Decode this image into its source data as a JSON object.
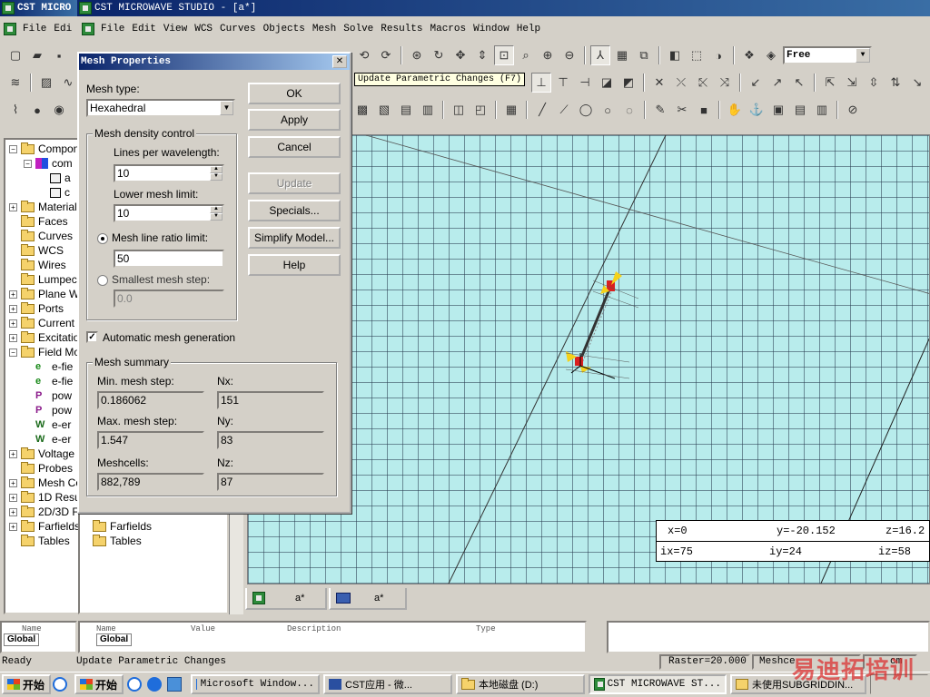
{
  "back_window": {
    "title": "CST MICRO"
  },
  "main_window": {
    "title": "CST MICROWAVE STUDIO - [a*]"
  },
  "back_menu": [
    {
      "label": "File",
      "u": "F",
      "rest": "ile"
    },
    {
      "label": "Edi",
      "u": "",
      "rest": "Edi"
    }
  ],
  "menu": [
    "File",
    "Edit",
    "View",
    "WCS",
    "Curves",
    "Objects",
    "Mesh",
    "Solve",
    "Results",
    "Macros",
    "Window",
    "Help"
  ],
  "toolbar": {
    "mode_select": "Free"
  },
  "tooltip": "Update Parametric Changes (F7)",
  "tree_left": {
    "items": [
      "Compon",
      "com",
      "a",
      "c",
      "Material",
      "Faces",
      "Curves",
      "WCS",
      "Wires",
      "Lumpec",
      "Plane W",
      "Ports",
      "Current",
      "Excitatio",
      "Field Mo",
      "e-fie",
      "e-fie",
      "pow",
      "pow",
      "e-er",
      "e-er",
      "Voltage",
      "Probes",
      "Mesh Co",
      "1D Resu",
      "2D/3D F",
      "Farfields",
      "Tables"
    ]
  },
  "tree_mid": {
    "items": [
      "Farfields",
      "Tables"
    ]
  },
  "dialog": {
    "title": "Mesh Properties",
    "mesh_type_label": "Mesh type:",
    "mesh_type_value": "Hexahedral",
    "density_group": "Mesh density control",
    "lines_per_wavelength_label": "Lines per wavelength:",
    "lines_per_wavelength_value": "10",
    "lower_mesh_limit_label": "Lower mesh limit:",
    "lower_mesh_limit_value": "10",
    "ratio_limit_label": "Mesh line ratio limit:",
    "ratio_limit_value": "50",
    "smallest_step_label": "Smallest mesh step:",
    "smallest_step_value": "0.0",
    "auto_mesh_label": "Automatic mesh generation",
    "summary_group": "Mesh summary",
    "min_step_label": "Min. mesh step:",
    "min_step_value": "0.186062",
    "nx_label": "Nx:",
    "nx_value": "151",
    "max_step_label": "Max. mesh step:",
    "max_step_value": "1.547",
    "ny_label": "Ny:",
    "ny_value": "83",
    "meshcells_label": "Meshcells:",
    "meshcells_value": "882,789",
    "nz_label": "Nz:",
    "nz_value": "87",
    "buttons": {
      "ok": "OK",
      "apply": "Apply",
      "cancel": "Cancel",
      "update": "Update",
      "specials": "Specials...",
      "simplify": "Simplify Model...",
      "help": "Help"
    }
  },
  "coords": {
    "x": "x=0",
    "y": "y=-20.152",
    "z": "z=16.2",
    "ix": "ix=75",
    "iy": "iy=24",
    "iz": "iz=58"
  },
  "tabs": [
    "a*",
    "a*"
  ],
  "param_list": {
    "left_tab": "Global",
    "right_tab": "Global",
    "headers": [
      "Name",
      "Value",
      "Description",
      "Type"
    ],
    "left_header": "Name"
  },
  "status": {
    "left": "Ready",
    "msg": "Update Parametric Changes",
    "raster": "Raster=20.000",
    "meshcells": "Meshce",
    "units": "cm"
  },
  "taskbar": {
    "start": "开始",
    "start2": "开始",
    "tasks": [
      "Microsoft Window...",
      "CST应用 - 微...",
      "本地磁盘 (D:)",
      "CST MICROWAVE ST...",
      "未使用SUBGRIDDIN..."
    ]
  },
  "watermark": "易迪拓培训"
}
